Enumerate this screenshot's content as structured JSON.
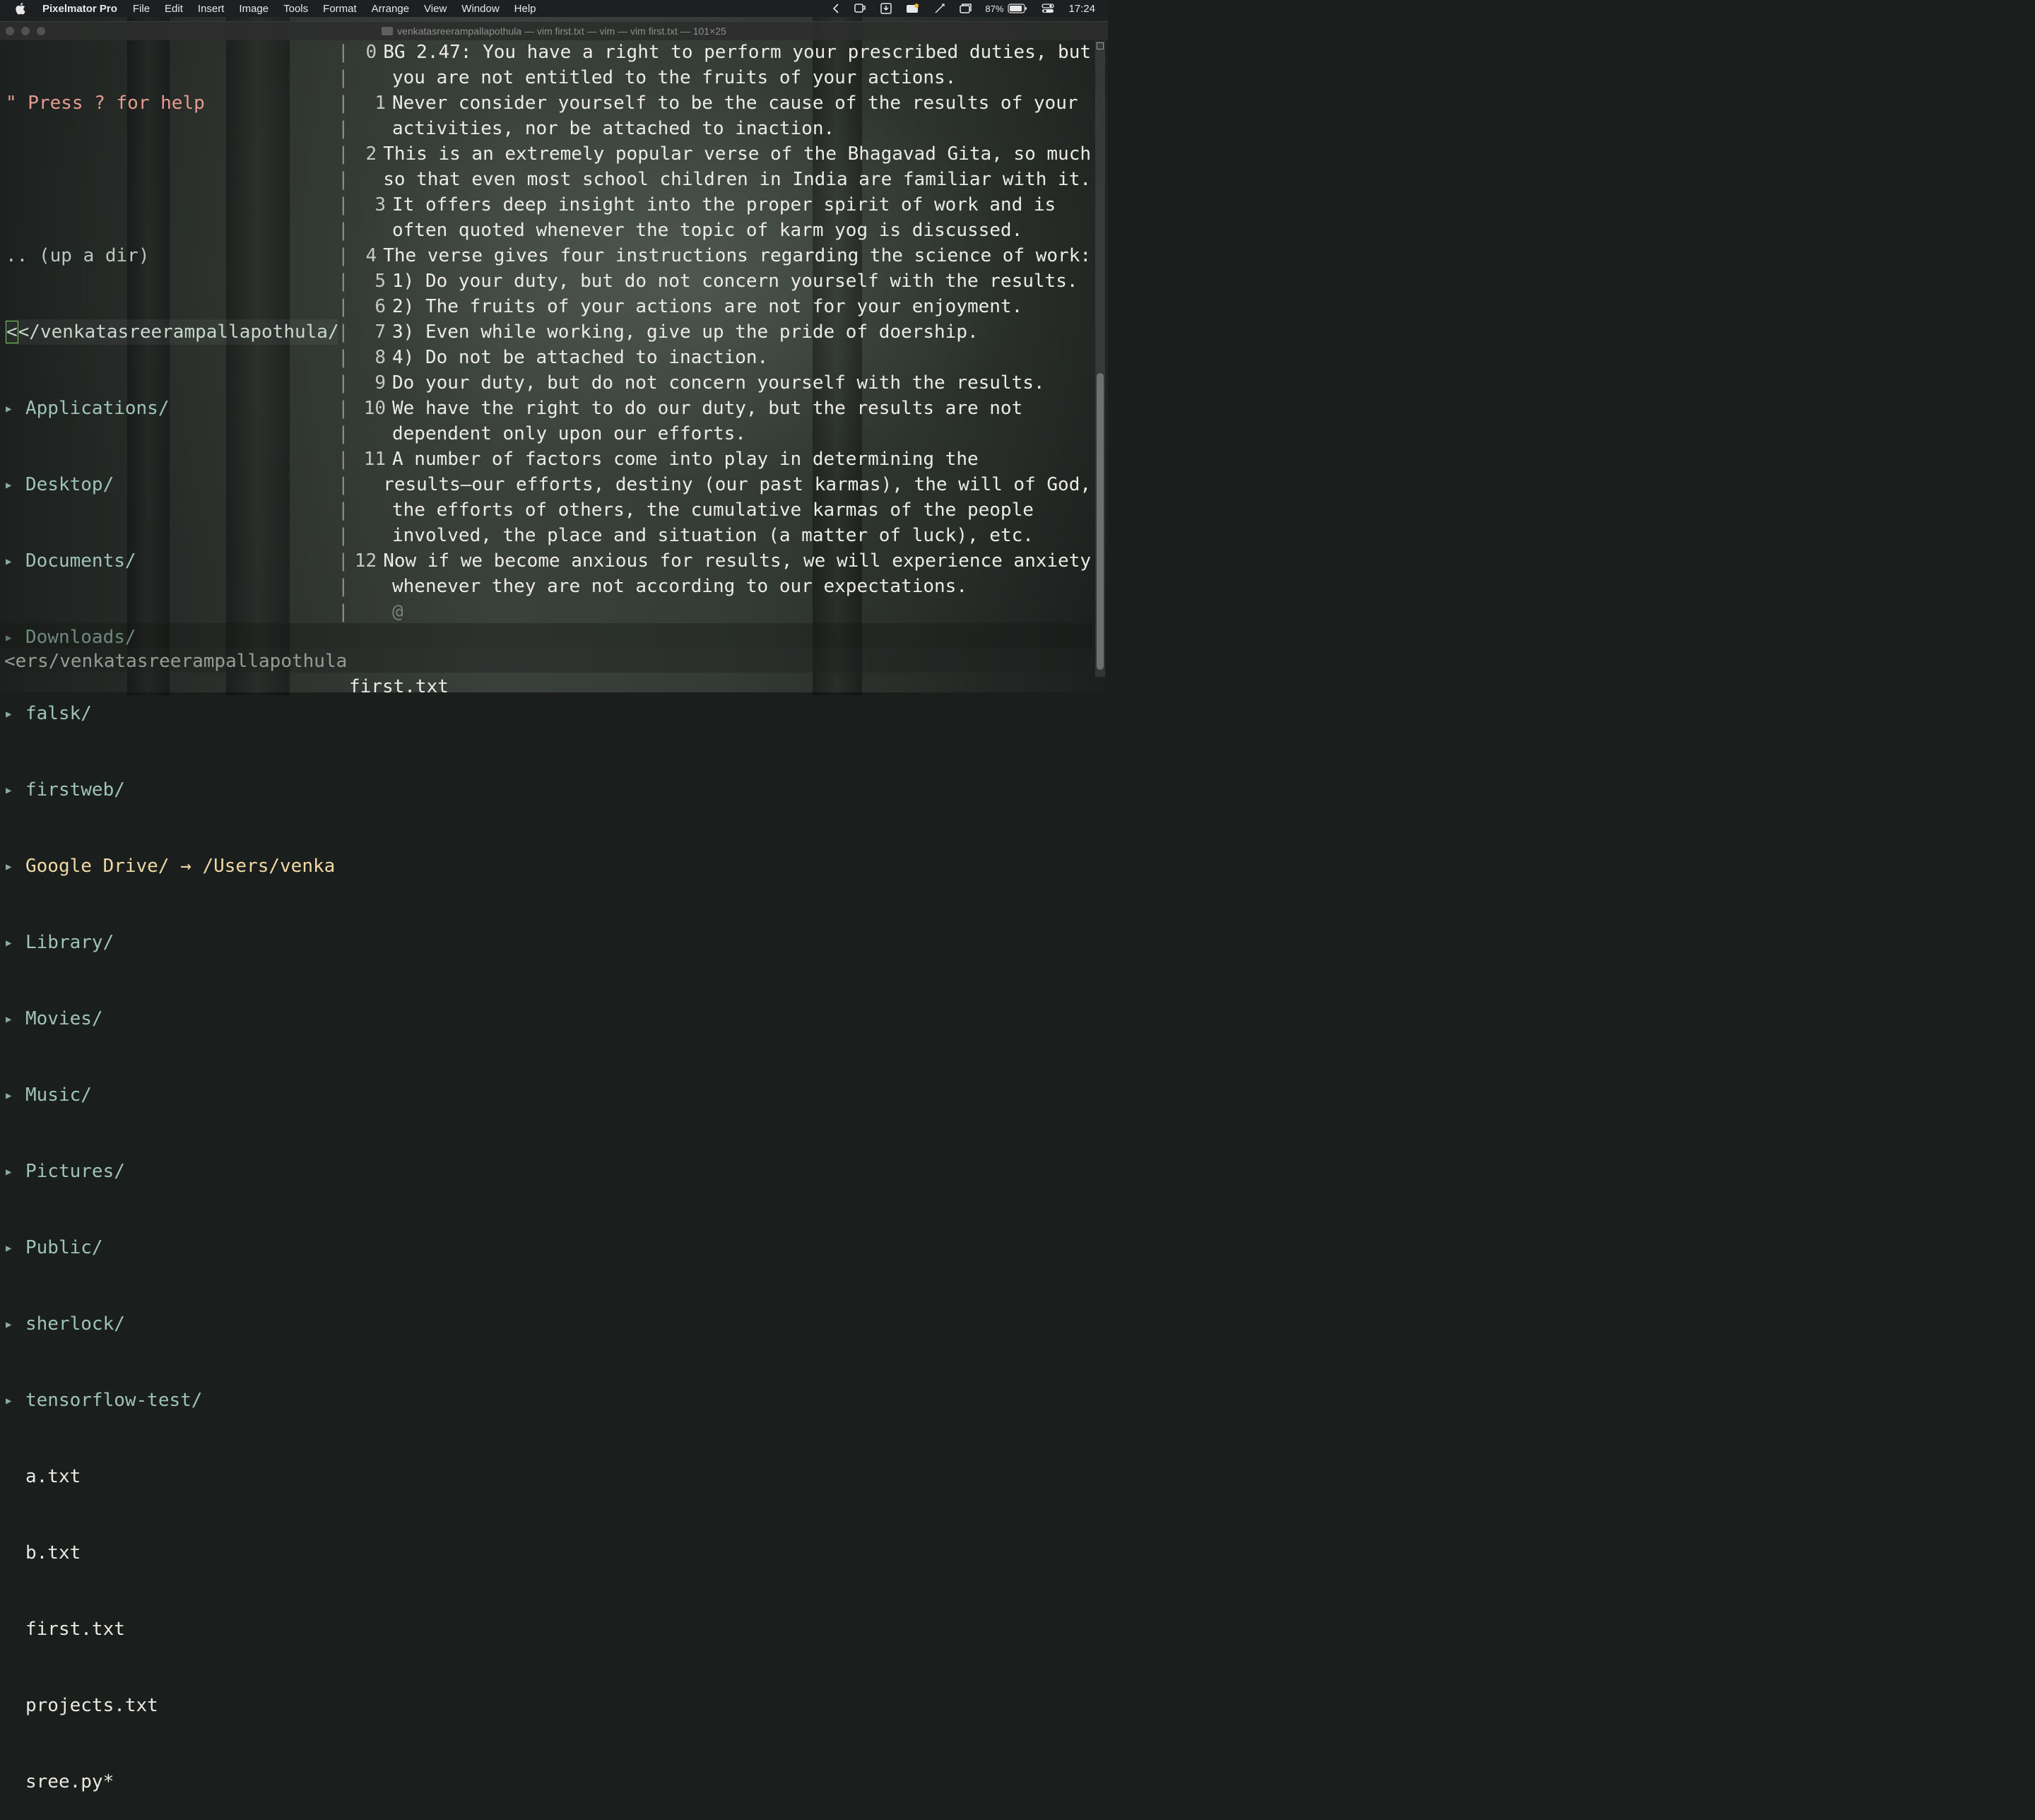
{
  "menubar": {
    "app_name": "Pixelmator Pro",
    "items": [
      "File",
      "Edit",
      "Insert",
      "Image",
      "Tools",
      "Format",
      "Arrange",
      "View",
      "Window",
      "Help"
    ],
    "battery_percent": "87%",
    "clock": "17:24"
  },
  "window": {
    "title": "venkatasreerampallapothula — vim first.txt — vim — vim first.txt — 101×25"
  },
  "tree": {
    "help": "\" Press ? for help",
    "updir": ".. (up a dir)",
    "cwd": "</venkatasreerampallapothula/",
    "dirs": [
      "Applications/",
      "Desktop/",
      "Documents/",
      "Downloads/",
      "falsk/",
      "firstweb/"
    ],
    "gdrive": "Google Drive/ → /Users/venka",
    "dirs2": [
      "Library/",
      "Movies/",
      "Music/",
      "Pictures/",
      "Public/",
      "sherlock/",
      "tensorflow-test/"
    ],
    "files": [
      "a.txt",
      "b.txt",
      "first.txt",
      "projects.txt",
      "sree.py*"
    ]
  },
  "editor": {
    "lines": [
      {
        "n": "0",
        "t": "BG 2.47: You have a right to perform your prescribed duties, but"
      },
      {
        "n": "",
        "t": "you are not entitled to the fruits of your actions."
      },
      {
        "n": "1",
        "t": "Never consider yourself to be the cause of the results of your"
      },
      {
        "n": "",
        "t": "activities, nor be attached to inaction."
      },
      {
        "n": "2",
        "t": "This is an extremely popular verse of the Bhagavad Gita, so much"
      },
      {
        "n": "",
        "t": "so that even most school children in India are familiar with it."
      },
      {
        "n": "3",
        "t": "It offers deep insight into the proper spirit of work and is"
      },
      {
        "n": "",
        "t": "often quoted whenever the topic of karm yog is discussed."
      },
      {
        "n": "4",
        "t": "The verse gives four instructions regarding the science of work:"
      },
      {
        "n": "5",
        "t": "1) Do your duty, but do not concern yourself with the results."
      },
      {
        "n": "6",
        "t": "2) The fruits of your actions are not for your enjoyment."
      },
      {
        "n": "7",
        "t": "3) Even while working, give up the pride of doership."
      },
      {
        "n": "8",
        "t": "4) Do not be attached to inaction."
      },
      {
        "n": "9",
        "t": "Do your duty, but do not concern yourself with the results."
      },
      {
        "n": "10",
        "t": "We have the right to do our duty, but the results are not"
      },
      {
        "n": "",
        "t": "dependent only upon our efforts."
      },
      {
        "n": "11",
        "t": "A number of factors come into play in determining the"
      },
      {
        "n": "",
        "t": "results—our efforts, destiny (our past karmas), the will of God,"
      },
      {
        "n": "",
        "t": "the efforts of others, the cumulative karmas of the people"
      },
      {
        "n": "",
        "t": "involved, the place and situation (a matter of luck), etc."
      },
      {
        "n": "12",
        "t": "Now if we become anxious for results, we will experience anxiety"
      },
      {
        "n": "",
        "t": "whenever they are not according to our expectations."
      }
    ],
    "end_marker": "@"
  },
  "status": {
    "tree_path": "<ers/venkatasreerampallapothula",
    "file_name": "first.txt"
  }
}
